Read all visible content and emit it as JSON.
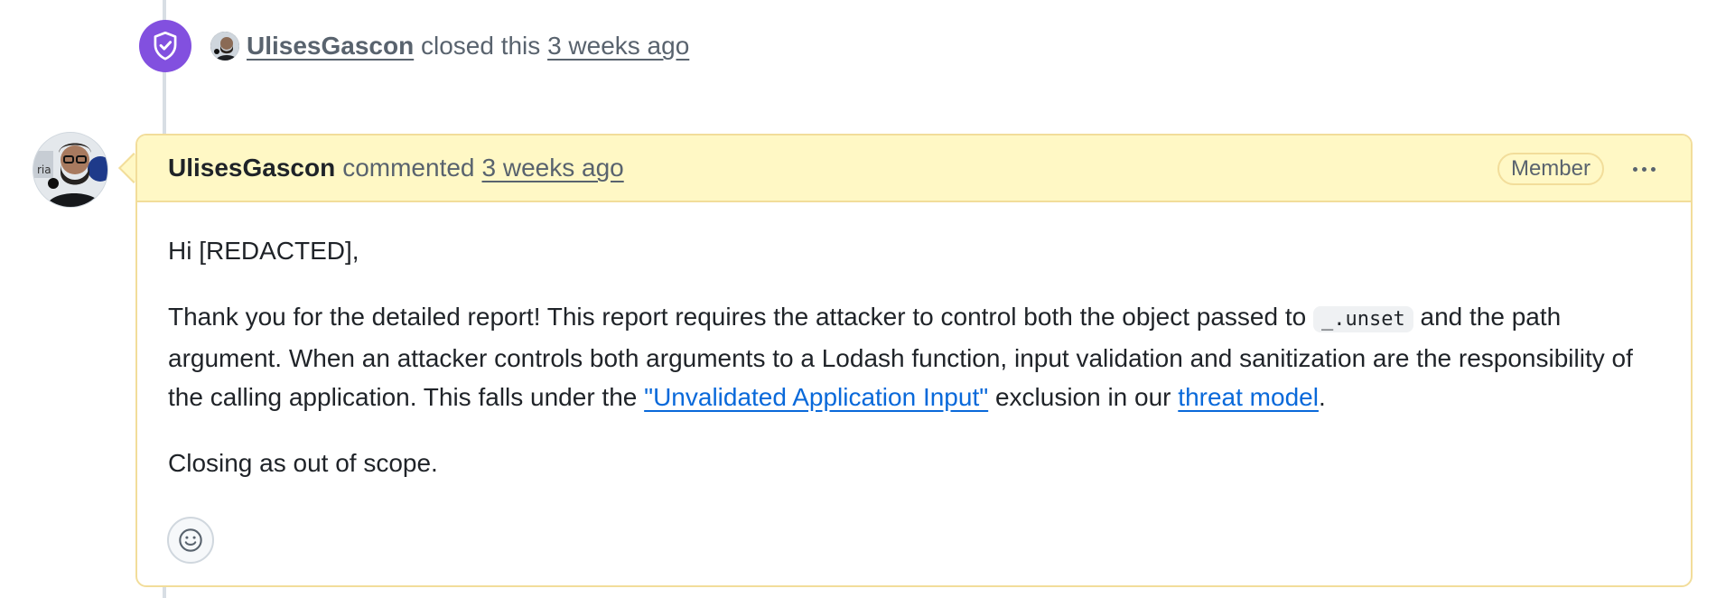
{
  "closed_event": {
    "author": "UlisesGascon",
    "action": "closed this",
    "time": "3 weeks ago"
  },
  "comment": {
    "author": "UlisesGascon",
    "action": "commented",
    "time": "3 weeks ago",
    "role_badge": "Member",
    "body": {
      "greeting": "Hi [REDACTED],",
      "p2_part1": "Thank you for the detailed report! This report requires the attacker to control both the object passed to",
      "code_unset": "_.unset",
      "p2_part2": "and the path argument. When an attacker controls both arguments to a Lodash function, input validation and sanitization are the responsibility of the calling application. This falls under the",
      "link_unvalidated": "\"Unvalidated Application Input\"",
      "p2_part3": "exclusion in our",
      "link_threat_model": "threat model",
      "p2_end": ".",
      "closing": "Closing as out of scope."
    }
  },
  "colors": {
    "badge_purple": "#8250df",
    "header_yellow": "#fff8c5",
    "border_yellow": "#f2dd9a",
    "link_blue": "#0969da"
  },
  "icons": [
    "shield-check-icon",
    "kebab-menu-icon",
    "smiley-icon"
  ]
}
